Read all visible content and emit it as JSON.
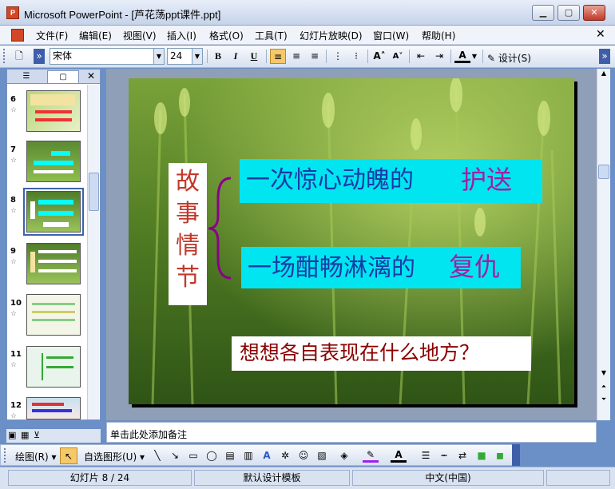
{
  "window": {
    "title": "Microsoft PowerPoint - [芦花荡ppt课件.ppt]",
    "app_icon_text": "P"
  },
  "menu": [
    "文件(F)",
    "编辑(E)",
    "视图(V)",
    "插入(I)",
    "格式(O)",
    "工具(T)",
    "幻灯片放映(D)",
    "窗口(W)",
    "帮助(H)"
  ],
  "toolbar": {
    "font_name": "宋体",
    "font_size": "24",
    "bold": "B",
    "italic": "I",
    "underline": "U",
    "font_color_label": "A",
    "design_label": "设计(S)"
  },
  "slides_panel": {
    "items": [
      {
        "number": "6"
      },
      {
        "number": "7"
      },
      {
        "number": "8",
        "selected": true
      },
      {
        "number": "9"
      },
      {
        "number": "10"
      },
      {
        "number": "11"
      },
      {
        "number": "12"
      }
    ]
  },
  "slide": {
    "heading_chars": [
      "故",
      "事",
      "情",
      "节"
    ],
    "line1_main": "一次惊心动魄的",
    "line1_emph": "护送",
    "line2_main": "一场酣畅淋漓的",
    "line2_emph": "复仇",
    "question": "想想各自表现在什么地方？"
  },
  "notes": {
    "placeholder": "单击此处添加备注"
  },
  "drawing_toolbar": {
    "draw_label": "绘图(R)",
    "autoshapes_label": "自选图形(U)"
  },
  "status": {
    "slide_info": "幻灯片 8 / 24",
    "design_template": "默认设计模板",
    "language": "中文(中国)"
  },
  "colors": {
    "heading_text": "#c0392b",
    "cyan_box": "#00e5f0",
    "line_text": "#1a3aa8",
    "emph_text": "#a020a0",
    "brace": "#8b008b",
    "question_text": "#8b0000"
  }
}
